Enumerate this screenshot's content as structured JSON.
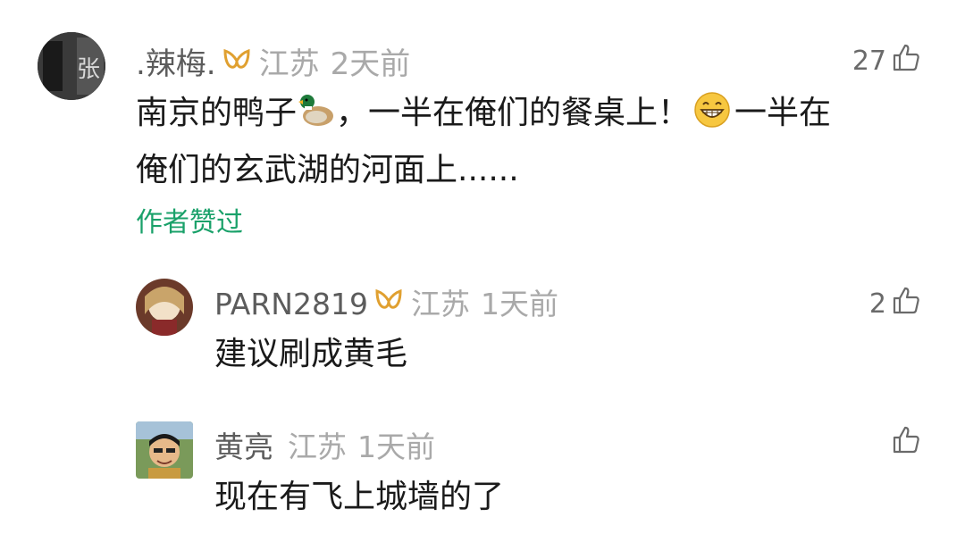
{
  "comments": [
    {
      "username": ".辣梅.",
      "location": "江苏",
      "time": "2天前",
      "likes": "27",
      "text_part1": "南京的鸭子",
      "text_part2": "，一半在俺们的餐桌上！",
      "text_part3": "一半在",
      "text_line2": "俺们的玄武湖的河面上......",
      "author_liked": "作者赞过",
      "avatar_text": "张"
    },
    {
      "username": "PARN2819",
      "location": "江苏",
      "time": "1天前",
      "likes": "2",
      "text": "建议刷成黄毛"
    },
    {
      "username": "黄亮",
      "location": "江苏",
      "time": "1天前",
      "likes": "",
      "text": "现在有飞上城墙的了"
    }
  ],
  "icons": {
    "vip": "vip-badge-icon",
    "like": "thumbs-up-icon",
    "duck": "duck-emoji-icon",
    "grin": "grinning-face-emoji-icon"
  },
  "colors": {
    "vip_badge": "#e0a030",
    "author_liked": "#1aa16a",
    "meta_gray": "#a9a9a9"
  }
}
